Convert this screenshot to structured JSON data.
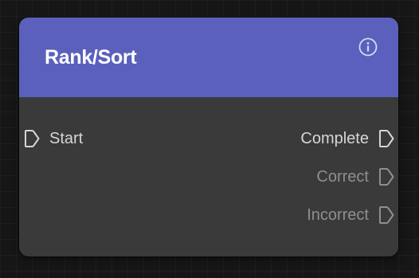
{
  "node": {
    "title": "Rank/Sort",
    "header_color": "#5a60bc",
    "body_color": "#3a3a3a",
    "info_icon": "info-circle-icon",
    "inputs": [
      {
        "label": "Start",
        "icon": "port-connector-icon"
      }
    ],
    "outputs": [
      {
        "label": "Complete",
        "icon": "port-connector-icon",
        "color": "#d6d6d6"
      },
      {
        "label": "Correct",
        "icon": "port-connector-icon",
        "color": "#8f8f8f"
      },
      {
        "label": "Incorrect",
        "icon": "port-connector-icon",
        "color": "#8f8f8f"
      }
    ]
  }
}
